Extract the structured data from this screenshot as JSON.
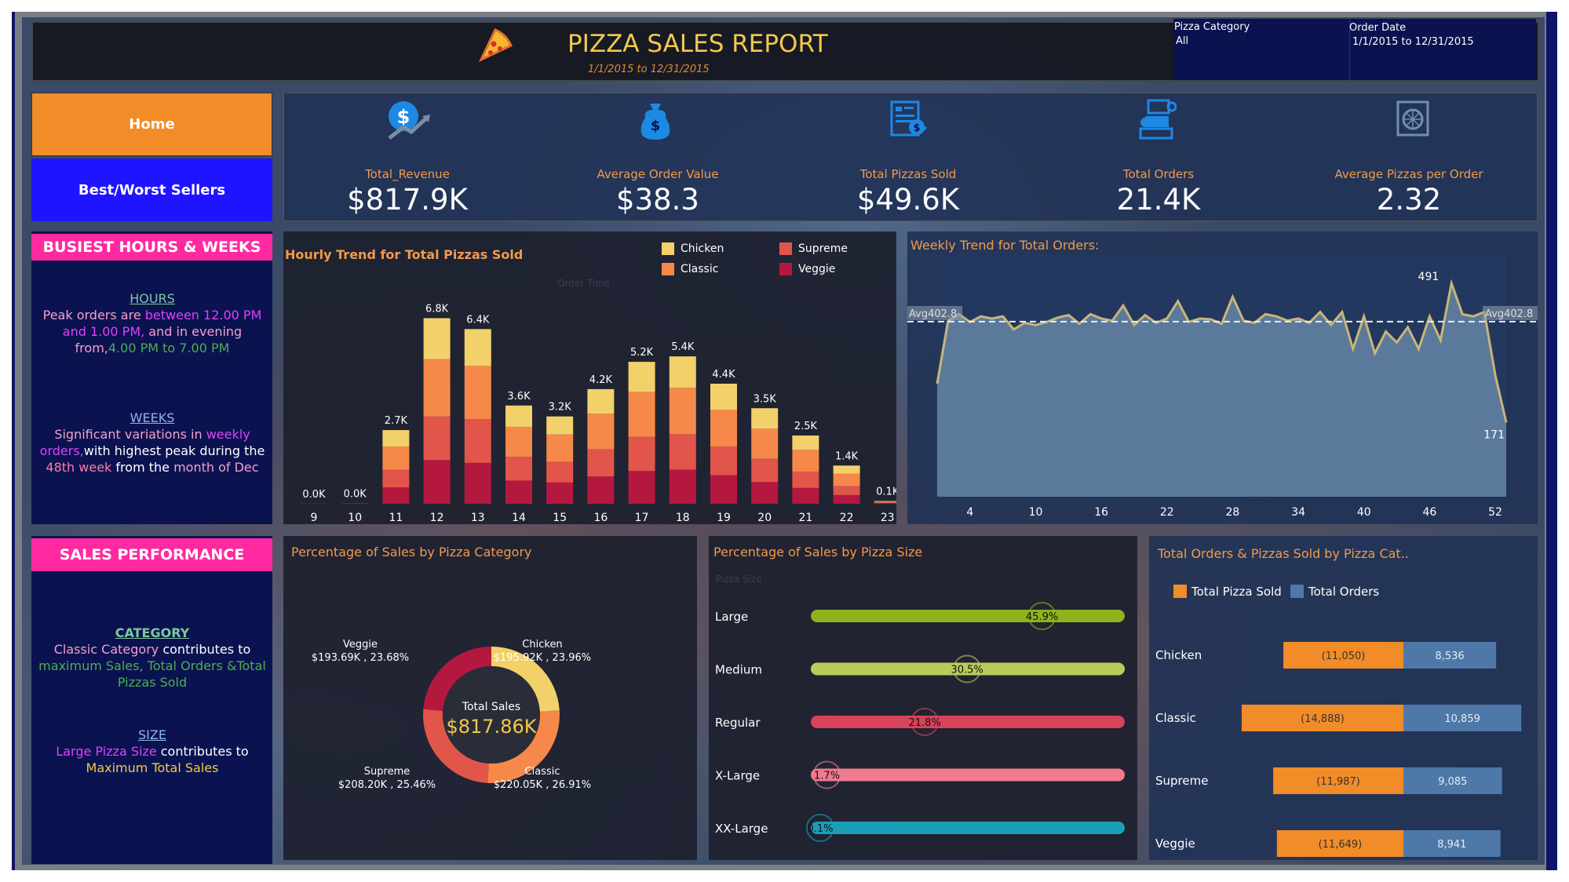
{
  "header": {
    "title": "PIZZA SALES REPORT",
    "date_range": "1/1/2015  to 12/31/2015",
    "filters": [
      {
        "label": "Pizza Category",
        "value": "All"
      },
      {
        "label": "Order Date",
        "value": "1/1/2015 to 12/31/2015"
      }
    ]
  },
  "nav": {
    "home": "Home",
    "best_worst": "Best/Worst Sellers"
  },
  "kpis": [
    {
      "label": "Total_Revenue",
      "value": "$817.9K",
      "icon": "revenue-icon"
    },
    {
      "label": "Average Order Value",
      "value": "$38.3",
      "icon": "money-bag-icon"
    },
    {
      "label": "Total Pizzas Sold",
      "value": "$49.6K",
      "icon": "invoice-icon"
    },
    {
      "label": "Total Orders",
      "value": "21.4K",
      "icon": "register-icon"
    },
    {
      "label": "Average Pizzas per Order",
      "value": "2.32",
      "icon": "pizza-box-icon"
    }
  ],
  "busiest": {
    "title": "BUSIEST HOURS & WEEKS",
    "hours_heading": "HOURS",
    "hours_text_1": "Peak orders are ",
    "hours_text_2": "between 12.00 PM and 1.00 PM,",
    "hours_text_3": " and in evening from,",
    "hours_text_4": "4.00 PM to 7.00 PM",
    "weeks_heading": "WEEKS",
    "weeks_text_1": "Significant variations in ",
    "weeks_text_2": "weekly orders,",
    "weeks_text_3": "with highest peak during the ",
    "weeks_text_4": "48th week",
    "weeks_text_5": " from the ",
    "weeks_text_6": "month of Dec"
  },
  "sales_perf": {
    "title": "SALES PERFORMANCE",
    "category_heading": "CATEGORY",
    "category_text_1": "Classic Category",
    "category_text_2": " contributes to ",
    "category_text_3": "maximum Sales, Total Orders &Total Pizzas Sold",
    "size_heading": "SIZE",
    "size_text_1": "Large Pizza Size",
    "size_text_2": " contributes to ",
    "size_text_3": "Maximum Total Sales"
  },
  "chart_data": [
    {
      "type": "bar",
      "title": "Hourly Trend for Total Pizzas Sold",
      "xlabel": "Order Time",
      "categories": [
        "9",
        "10",
        "11",
        "12",
        "13",
        "14",
        "15",
        "16",
        "17",
        "18",
        "19",
        "20",
        "21",
        "22",
        "23"
      ],
      "totals_labels": [
        "0.0K",
        "0.0K",
        "2.7K",
        "6.8K",
        "6.4K",
        "3.6K",
        "3.2K",
        "4.2K",
        "5.2K",
        "5.4K",
        "4.4K",
        "3.5K",
        "2.5K",
        "1.4K",
        "0.1K"
      ],
      "series": [
        {
          "name": "Veggie",
          "color": "#b5183f",
          "values": [
            1,
            2,
            600,
            1600,
            1500,
            850,
            780,
            1000,
            1200,
            1250,
            1050,
            800,
            580,
            320,
            25
          ]
        },
        {
          "name": "Supreme",
          "color": "#e2554a",
          "values": [
            1,
            2,
            650,
            1600,
            1600,
            870,
            760,
            1000,
            1250,
            1300,
            1050,
            850,
            600,
            330,
            25
          ]
        },
        {
          "name": "Classic",
          "color": "#f6894a",
          "values": [
            1,
            2,
            850,
            2100,
            1950,
            1100,
            1000,
            1300,
            1650,
            1700,
            1350,
            1100,
            800,
            450,
            30
          ]
        },
        {
          "name": "Chicken",
          "color": "#f3d16a",
          "values": [
            1,
            2,
            600,
            1500,
            1350,
            780,
            660,
            900,
            1100,
            1150,
            950,
            750,
            520,
            300,
            20
          ]
        }
      ],
      "legend": "top-right"
    },
    {
      "type": "area",
      "title": "Weekly Trend for Total Orders:",
      "x": [
        1,
        2,
        3,
        4,
        5,
        6,
        7,
        8,
        9,
        10,
        11,
        12,
        13,
        14,
        15,
        16,
        17,
        18,
        19,
        20,
        21,
        22,
        23,
        24,
        25,
        26,
        27,
        28,
        29,
        30,
        31,
        32,
        33,
        34,
        35,
        36,
        37,
        38,
        39,
        40,
        41,
        42,
        43,
        44,
        45,
        46,
        47,
        48,
        49,
        50,
        51,
        52,
        53
      ],
      "values": [
        260,
        405,
        420,
        402,
        415,
        410,
        415,
        385,
        400,
        395,
        402,
        412,
        418,
        398,
        420,
        410,
        405,
        440,
        395,
        418,
        400,
        410,
        450,
        402,
        410,
        408,
        398,
        460,
        405,
        400,
        420,
        415,
        405,
        410,
        400,
        425,
        395,
        425,
        340,
        415,
        330,
        380,
        355,
        390,
        340,
        415,
        360,
        491,
        420,
        415,
        425,
        280,
        171
      ],
      "xticks": [
        4,
        10,
        16,
        22,
        28,
        34,
        40,
        46,
        52
      ],
      "avg_label": "Avg402.8",
      "avg": 402.8,
      "max_label": "491",
      "min_label": "171"
    },
    {
      "type": "pie",
      "title": "Percentage of Sales by Pizza Category",
      "center_label": "Total Sales",
      "center_value": "$817.86K",
      "slices": [
        {
          "name": "Chicken",
          "label": "$195.92K , 23.96%",
          "value": 23.96,
          "color": "#f3d16a"
        },
        {
          "name": "Classic",
          "label": "$220.05K , 26.91%",
          "value": 26.91,
          "color": "#f6894a"
        },
        {
          "name": "Supreme",
          "label": "$208.20K , 25.46%",
          "value": 25.46,
          "color": "#e2554a"
        },
        {
          "name": "Veggie",
          "label": "$193.69K , 23.68%",
          "value": 23.68,
          "color": "#b5183f"
        }
      ]
    },
    {
      "type": "bar",
      "title": "Percentage of Sales by Pizza Size",
      "ylabel": "Pizza Size",
      "categories": [
        "Large",
        "Medium",
        "Regular",
        "X-Large",
        "XX-Large"
      ],
      "values": [
        45.9,
        30.5,
        21.8,
        1.7,
        0.1
      ],
      "value_labels": [
        "45.9%",
        "30.5%",
        "21.8%",
        "1.7%",
        "0.1%"
      ],
      "colors": [
        "#8fb31a",
        "#b9cc5a",
        "#d9435a",
        "#f07a8e",
        "#1a9fb8"
      ]
    },
    {
      "type": "bar",
      "title": "Total Orders & Pizzas Sold by Pizza Cat..",
      "categories": [
        "Chicken",
        "Classic",
        "Supreme",
        "Veggie"
      ],
      "series": [
        {
          "name": "Total Pizza Sold",
          "color": "#f28c28",
          "values": [
            11050,
            14888,
            11987,
            11649
          ],
          "labels": [
            "(11,050)",
            "(14,888)",
            "(11,987)",
            "(11,649)"
          ]
        },
        {
          "name": "Total Orders",
          "color": "#4e78a8",
          "values": [
            8536,
            10859,
            9085,
            8941
          ],
          "labels": [
            "8,536",
            "10,859",
            "9,085",
            "8,941"
          ]
        }
      ],
      "legend": "top"
    }
  ]
}
